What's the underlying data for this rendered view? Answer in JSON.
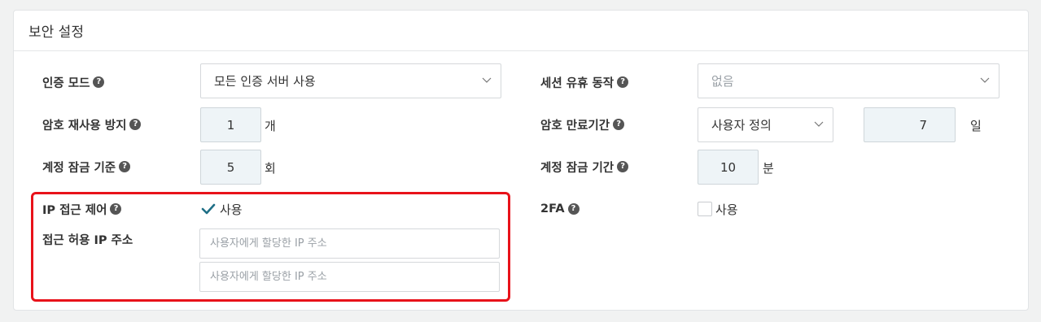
{
  "panel": {
    "title": "보안 설정"
  },
  "fields": {
    "auth_mode": {
      "label": "인증 모드",
      "value": "모든 인증 서버 사용"
    },
    "session_action": {
      "label": "세션 유휴 동작",
      "value": "없음"
    },
    "pw_reuse": {
      "label": "암호 재사용 방지",
      "value": "1",
      "unit": "개"
    },
    "pw_expiry": {
      "label": "암호 만료기간",
      "type_value": "사용자 정의",
      "value": "7",
      "unit": "일"
    },
    "lock_threshold": {
      "label": "계정 잠금 기준",
      "value": "5",
      "unit": "회"
    },
    "lock_duration": {
      "label": "계정 잠금 기간",
      "value": "10",
      "unit": "분"
    },
    "ip_control": {
      "label": "IP 접근 제어",
      "checkbox_label": "사용",
      "checked": true
    },
    "twofa": {
      "label": "2FA",
      "checkbox_label": "사용",
      "checked": false
    },
    "allowed_ip": {
      "label": "접근 허용 IP 주소",
      "placeholders": [
        "사용자에게 할당한 IP 주소",
        "사용자에게 할당한 IP 주소"
      ]
    }
  },
  "icons": {
    "help": "?",
    "chevron": "chevron-down-icon",
    "check": "check-icon"
  },
  "colors": {
    "highlight": "#e8121a",
    "check": "#1f6f86",
    "input_bg": "#eef4f7"
  }
}
